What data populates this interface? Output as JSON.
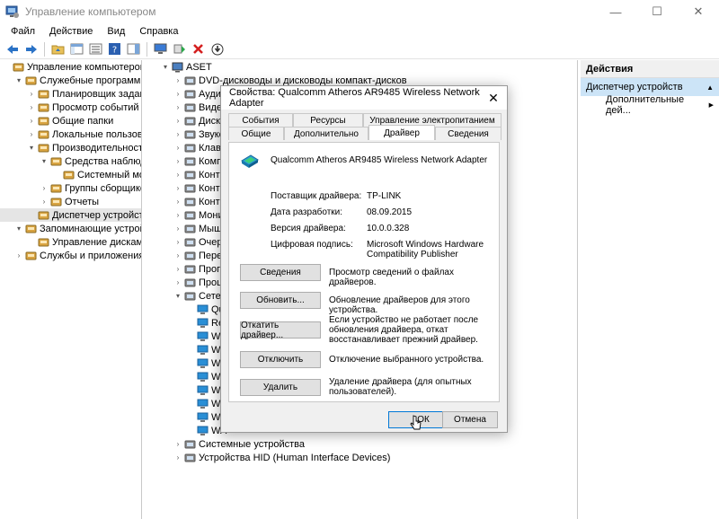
{
  "window": {
    "title": "Управление компьютером",
    "minimize": "—",
    "maximize": "☐",
    "close": "✕"
  },
  "menu": [
    "Файл",
    "Действие",
    "Вид",
    "Справка"
  ],
  "left_tree": [
    {
      "label": "Управление компьютером (л",
      "indent": 0,
      "arrow": ""
    },
    {
      "label": "Служебные программы",
      "indent": 1,
      "arrow": "▾"
    },
    {
      "label": "Планировщик заданий",
      "indent": 2,
      "arrow": "›"
    },
    {
      "label": "Просмотр событий",
      "indent": 2,
      "arrow": "›"
    },
    {
      "label": "Общие папки",
      "indent": 2,
      "arrow": "›"
    },
    {
      "label": "Локальные пользовате",
      "indent": 2,
      "arrow": "›"
    },
    {
      "label": "Производительность",
      "indent": 2,
      "arrow": "▾"
    },
    {
      "label": "Средства наблюде",
      "indent": 3,
      "arrow": "▾"
    },
    {
      "label": "Системный мо",
      "indent": 4,
      "arrow": ""
    },
    {
      "label": "Группы сборщико",
      "indent": 3,
      "arrow": "›"
    },
    {
      "label": "Отчеты",
      "indent": 3,
      "arrow": "›"
    },
    {
      "label": "Диспетчер устройств",
      "indent": 2,
      "arrow": "",
      "selected": true
    },
    {
      "label": "Запоминающие устройств",
      "indent": 1,
      "arrow": "▾"
    },
    {
      "label": "Управление дисками",
      "indent": 2,
      "arrow": ""
    },
    {
      "label": "Службы и приложения",
      "indent": 1,
      "arrow": "›"
    }
  ],
  "device_tree": [
    {
      "label": "ASET",
      "indent": 0,
      "arrow": "▾"
    },
    {
      "label": "DVD-дисководы и дисководы компакт-дисков",
      "indent": 1,
      "arrow": "›"
    },
    {
      "label": "Аудио",
      "indent": 1,
      "arrow": "›"
    },
    {
      "label": "Видео",
      "indent": 1,
      "arrow": "›"
    },
    {
      "label": "Диско",
      "indent": 1,
      "arrow": "›"
    },
    {
      "label": "Звуко",
      "indent": 1,
      "arrow": "›"
    },
    {
      "label": "Клави",
      "indent": 1,
      "arrow": "›"
    },
    {
      "label": "Компь",
      "indent": 1,
      "arrow": "›"
    },
    {
      "label": "Контр",
      "indent": 1,
      "arrow": "›"
    },
    {
      "label": "Контр",
      "indent": 1,
      "arrow": "›"
    },
    {
      "label": "Контр",
      "indent": 1,
      "arrow": "›"
    },
    {
      "label": "Монит",
      "indent": 1,
      "arrow": "›"
    },
    {
      "label": "Мыши",
      "indent": 1,
      "arrow": "›"
    },
    {
      "label": "Очере",
      "indent": 1,
      "arrow": "›"
    },
    {
      "label": "Перен",
      "indent": 1,
      "arrow": "›"
    },
    {
      "label": "Прогр",
      "indent": 1,
      "arrow": "›"
    },
    {
      "label": "Проце",
      "indent": 1,
      "arrow": "›"
    },
    {
      "label": "Сетев",
      "indent": 1,
      "arrow": "▾"
    },
    {
      "label": "Qu",
      "indent": 2,
      "arrow": ""
    },
    {
      "label": "Re",
      "indent": 2,
      "arrow": ""
    },
    {
      "label": "WA",
      "indent": 2,
      "arrow": ""
    },
    {
      "label": "WA",
      "indent": 2,
      "arrow": ""
    },
    {
      "label": "WA",
      "indent": 2,
      "arrow": ""
    },
    {
      "label": "WA",
      "indent": 2,
      "arrow": ""
    },
    {
      "label": "WA",
      "indent": 2,
      "arrow": ""
    },
    {
      "label": "WA",
      "indent": 2,
      "arrow": ""
    },
    {
      "label": "WA",
      "indent": 2,
      "arrow": ""
    },
    {
      "label": "WA",
      "indent": 2,
      "arrow": ""
    },
    {
      "label": "Системные устройства",
      "indent": 1,
      "arrow": "›"
    },
    {
      "label": "Устройства HID (Human Interface Devices)",
      "indent": 1,
      "arrow": "›"
    }
  ],
  "actions": {
    "header": "Действия",
    "section": "Диспетчер устройств",
    "more": "Дополнительные дей...",
    "section_arrow": "▲",
    "more_arrow": "▶"
  },
  "dialog": {
    "title": "Свойства: Qualcomm Atheros AR9485 Wireless Network Adapter",
    "close": "✕",
    "tabs_row1": [
      "События",
      "Ресурсы",
      "Управление электропитанием"
    ],
    "tabs_row2": [
      "Общие",
      "Дополнительно",
      "Драйвер",
      "Сведения"
    ],
    "active_tab": "Драйвер",
    "device_name": "Qualcomm Atheros AR9485 Wireless Network Adapter",
    "info": [
      {
        "label": "Поставщик драйвера:",
        "value": "TP-LINK"
      },
      {
        "label": "Дата разработки:",
        "value": "08.09.2015"
      },
      {
        "label": "Версия драйвера:",
        "value": "10.0.0.328"
      },
      {
        "label": "Цифровая подпись:",
        "value": "Microsoft Windows Hardware Compatibility Publisher"
      }
    ],
    "buttons": [
      {
        "label": "Сведения",
        "desc": "Просмотр сведений о файлах драйверов."
      },
      {
        "label": "Обновить...",
        "desc": "Обновление драйверов для этого устройства."
      },
      {
        "label": "Откатить драйвер...",
        "desc": "Если устройство не работает после обновления драйвера, откат восстанавливает прежний драйвер."
      },
      {
        "label": "Отключить",
        "desc": "Отключение выбранного устройства."
      },
      {
        "label": "Удалить",
        "desc": "Удаление драйвера (для опытных пользователей)."
      }
    ],
    "ok": "ОК",
    "cancel": "Отмена"
  }
}
